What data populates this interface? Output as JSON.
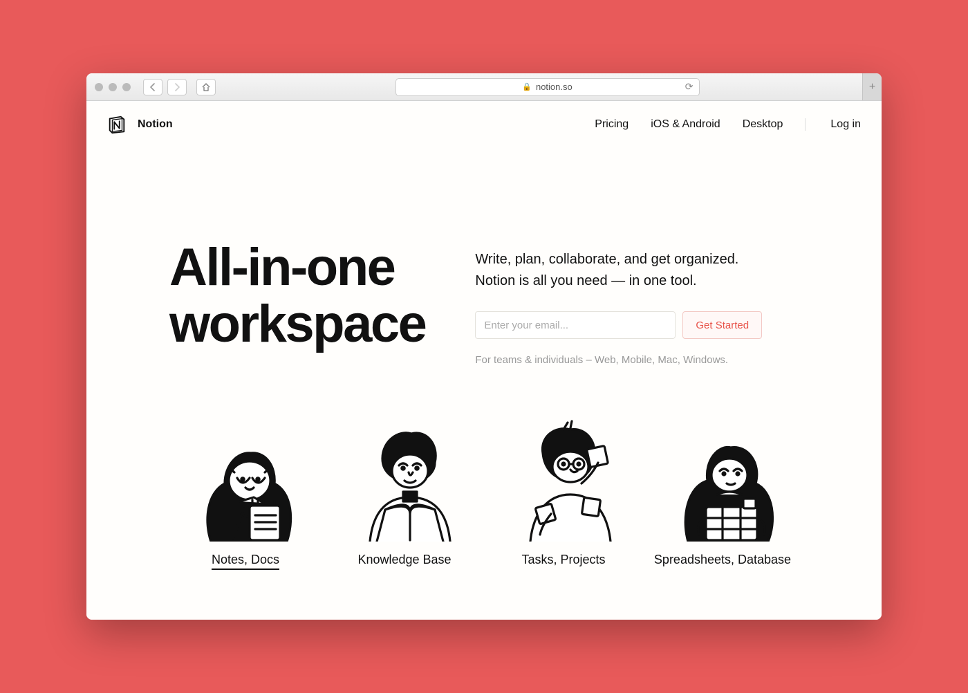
{
  "browser": {
    "url": "notion.so"
  },
  "nav": {
    "brand": "Notion",
    "links": [
      "Pricing",
      "iOS & Android",
      "Desktop"
    ],
    "login": "Log in"
  },
  "hero": {
    "title_line1": "All-in-one",
    "title_line2": "workspace",
    "subtitle_line1": "Write, plan, collaborate, and get organized.",
    "subtitle_line2": "Notion is all you need — in one tool.",
    "email_placeholder": "Enter your email...",
    "cta": "Get Started",
    "meta": "For teams & individuals – Web, Mobile, Mac, Windows."
  },
  "features": [
    {
      "label": "Notes, Docs",
      "active": true
    },
    {
      "label": "Knowledge Base",
      "active": false
    },
    {
      "label": "Tasks, Projects",
      "active": false
    },
    {
      "label": "Spreadsheets, Database",
      "active": false
    }
  ]
}
